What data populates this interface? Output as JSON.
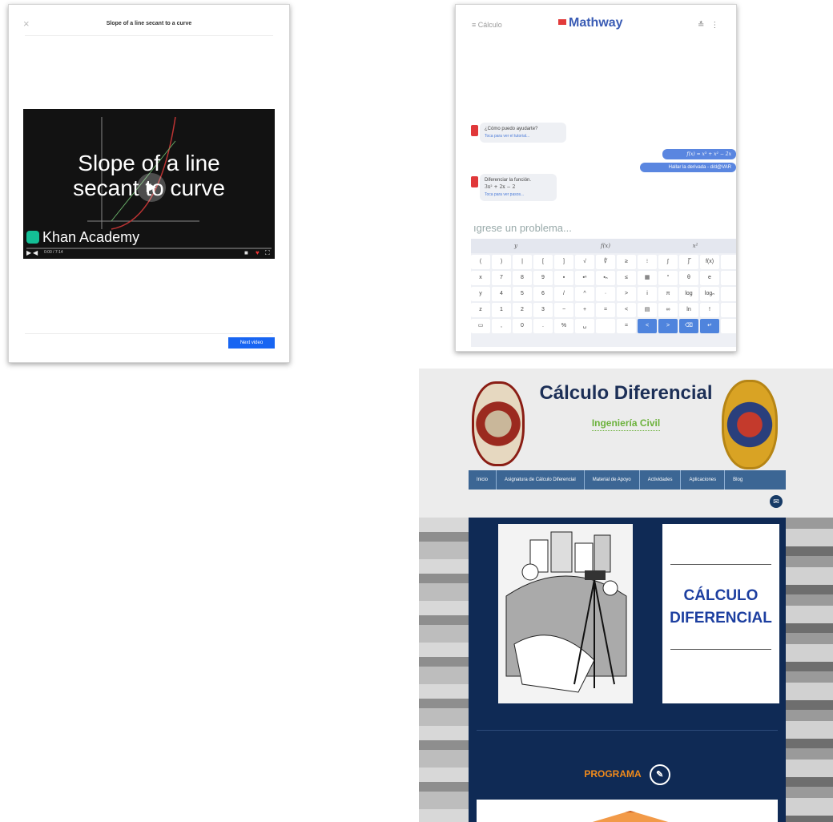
{
  "khan": {
    "close_icon": "×",
    "title": "Slope of a line secant to a curve",
    "video_title_line1": "Slope of a line",
    "video_title_line2": "secant to curve",
    "brand": "Khan Academy",
    "time": "0:00 / 7:14",
    "next_button": "Next video"
  },
  "mathway": {
    "menu": "≡ Cálculo",
    "logo": "Mathway",
    "bot_msg_1": "¿Cómo puedo ayudarte?",
    "bot_hint_1": "Toca para ver el tutorial...",
    "user_expr": "f(x) = x³ + x² − 2x",
    "user_action": "Hallar la derivada - d/d@VAR",
    "bot_msg_2": "Diferenciar la función.",
    "bot_result": "3x² + 2x − 2",
    "bot_hint_2": "Toca para ver pasos...",
    "input_placeholder": "ıgrese un problema...",
    "keyboard_tabs": [
      "y",
      "f(x)",
      "x²"
    ],
    "keys": [
      "(",
      ")",
      "|",
      "[",
      "]",
      "√",
      "∜",
      "≥",
      "⁝",
      "∫",
      "∫̅",
      "f(x)",
      "",
      "x",
      "7",
      "8",
      "9",
      "▪",
      "▪ⁿ",
      "▪ₙ",
      "≤",
      "▦",
      "°",
      "θ",
      "e",
      "",
      "y",
      "4",
      "5",
      "6",
      "/",
      "^",
      "·",
      ">",
      "i",
      "π",
      "log",
      "logₙ",
      "",
      "z",
      "1",
      "2",
      "3",
      "−",
      "+",
      "=",
      "<",
      "▤",
      "∞",
      "ln",
      "!",
      "",
      "▭",
      ",",
      "0",
      ".",
      "%",
      "␣",
      "",
      "=",
      "<",
      ">",
      "⌫",
      "↵",
      ""
    ]
  },
  "site": {
    "title": "Cálculo Diferencial",
    "subtitle": "Ingeniería Civil",
    "nav": [
      "Inicio",
      "Asignatura de Cálculo Diferencial",
      "Material de Apoyo",
      "Actividades",
      "Aplicaciones",
      "Blog"
    ],
    "heading_line1": "CÁLCULO",
    "heading_line2": "DIFERENCIAL",
    "section": "PROGRAMA",
    "pencil_icon": "✎",
    "mail_icon": "✉"
  }
}
